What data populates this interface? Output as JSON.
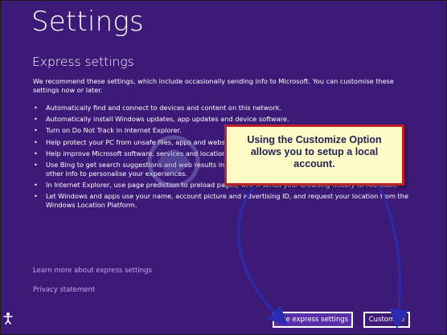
{
  "page": {
    "title": "Settings",
    "section_title": "Express settings",
    "intro": "We recommend these settings, which include occasionally sending info to Microsoft. You can customise these settings now or later.",
    "bullet_glyph": "•",
    "bullets": [
      "Automatically find and connect to devices and content on this network.",
      "Automatically install Windows updates, app updates and device software.",
      "Turn on Do Not Track in Internet Explorer.",
      "Help protect your PC from unsafe files, apps and website",
      "Help improve Microsoft software, services and location s",
      "Use Bing to get search suggestions and web results in W",
      "other info to personalise your experiences.",
      "In Internet Explorer, use page prediction to preload pages, which sends your browsing history to Microsoft.",
      "Let Windows and apps use your name, account picture and advertising ID, and request your location from the Windows Location Platform."
    ],
    "links": {
      "learn_more": "Learn more about express settings",
      "privacy": "Privacy statement"
    },
    "buttons": {
      "express": "Use express settings",
      "customise": "Customise"
    }
  },
  "annotation": {
    "callout_lines": [
      "Using the Customize Option",
      "allows you to setup a local",
      "account."
    ],
    "border_color": "#c0202a",
    "fill_color": "#fffbc6",
    "arrow_color": "#2b2bb0"
  },
  "colors": {
    "background": "#3d1a78",
    "text": "#ffffff",
    "link": "#c8a4f0"
  },
  "icons": {
    "ease_of_access": "ease-of-access-icon",
    "watermark": "watermark-logo-icon"
  }
}
